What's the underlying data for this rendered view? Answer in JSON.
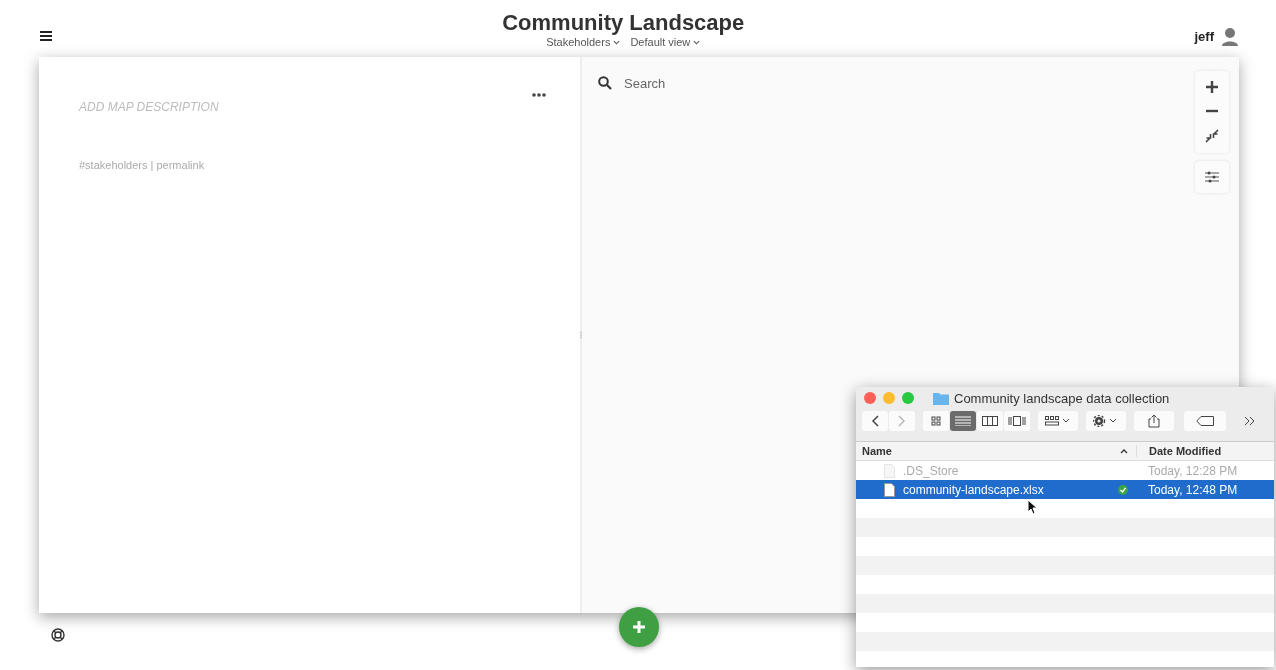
{
  "header": {
    "title": "Community Landscape",
    "menus": [
      {
        "label": "Stakeholders"
      },
      {
        "label": "Default view"
      }
    ],
    "user": {
      "name": "jeff"
    }
  },
  "description": {
    "placeholder": "ADD MAP DESCRIPTION",
    "links": "#stakeholders | permalink"
  },
  "search": {
    "placeholder": "Search"
  },
  "finder": {
    "title": "Community landscape data collection",
    "view_modes": [
      {
        "kind": "icons",
        "selected": false
      },
      {
        "kind": "list",
        "selected": true
      },
      {
        "kind": "columns",
        "selected": false
      },
      {
        "kind": "coverflow",
        "selected": false
      }
    ],
    "columns": [
      "Name",
      "Date Modified"
    ],
    "files": [
      {
        "name": ".DS_Store",
        "date": "Today, 12:28 PM",
        "hidden": true,
        "synced": false,
        "selected": false
      },
      {
        "name": "community-landscape.xlsx",
        "date": "Today, 12:48 PM",
        "hidden": false,
        "synced": true,
        "selected": true
      }
    ]
  }
}
